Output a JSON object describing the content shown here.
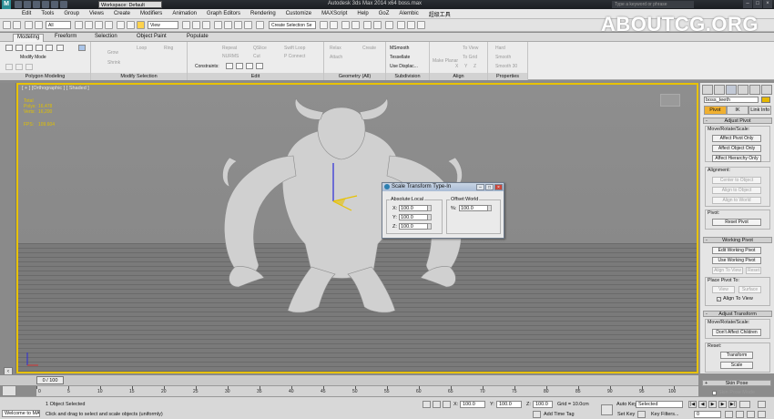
{
  "titlebar": {
    "title": "Autodesk 3ds Max  2014 x64       boss.max",
    "workspace": "Workspace: Default",
    "search_placeholder": "Type a keyword or phrase",
    "logo": "M"
  },
  "watermark": "ABOUTCG.ORG",
  "menu": [
    "Edit",
    "Tools",
    "Group",
    "Views",
    "Create",
    "Modifiers",
    "Animation",
    "Graph Editors",
    "Rendering",
    "Customize",
    "MAXScript",
    "Help",
    "GoZ",
    "Alembic",
    "超级工具"
  ],
  "toolbar": {
    "filter": "All",
    "refcoord": "View",
    "selection_set": "Create Selection Se"
  },
  "ribbon_tabs": [
    "Modeling",
    "Freeform",
    "Selection",
    "Object Paint",
    "Populate"
  ],
  "ribbon": {
    "groups": [
      "Polygon Modeling",
      "Modify Selection",
      "Edit",
      "Geometry (All)",
      "Subdivision",
      "Align",
      "Properties"
    ],
    "modify_mode": "Modify Mode",
    "modsel": [
      "Grow",
      "Shrink",
      "Loop",
      "Ring"
    ],
    "edit": [
      "Repeat",
      "NURMS",
      "QSlice",
      "Cut",
      "Swift Loop",
      "P Connect"
    ],
    "constraints_label": "Constraints:",
    "geometry": [
      "Relax",
      "Attach",
      "Create"
    ],
    "subdivision": [
      "MSmooth",
      "Tessellate",
      "Use Displac..."
    ],
    "make_planar": "Make Planar",
    "align": [
      "To View",
      "To Grid",
      "X",
      "Y",
      "Z"
    ],
    "properties": [
      "Hard",
      "Smooth",
      "Smooth 30"
    ]
  },
  "viewport": {
    "label": "[ + ] [Orthographic ] [ Shaded ]",
    "stats": {
      "total_label": "Total",
      "polys_label": "Polys:",
      "polys_value": "16,478",
      "verts_label": "Verts:",
      "verts_value": "16,200",
      "fps_label": "FPS:",
      "fps_value": "109.604"
    }
  },
  "dialog": {
    "title": "Scale Transform Type-In",
    "absolute_legend": "Absolute:Local",
    "offset_legend": "Offset:World",
    "x_label": "X:",
    "x_value": "100.0",
    "y_label": "Y:",
    "y_value": "100.0",
    "z_label": "Z:",
    "z_value": "100.0",
    "pct_label": "%:",
    "pct_value": "100.0"
  },
  "cmdpanel": {
    "object_name": "boss_teeth",
    "tabs": [
      "Pivot",
      "IK",
      "Link Info"
    ],
    "adjust_pivot": "Adjust Pivot",
    "move_rotate_scale": "Move/Rotate/Scale:",
    "affect_pivot": "Affect Pivot Only",
    "affect_object": "Affect Object Only",
    "affect_hierarchy": "Affect Hierarchy Only",
    "alignment": "Alignment:",
    "center_to_object": "Center to Object",
    "align_to_object": "Align to Object",
    "align_to_world": "Align to World",
    "pivot_label": "Pivot:",
    "reset_pivot": "Reset Pivot",
    "working_pivot": "Working Pivot",
    "edit_working_pivot": "Edit Working Pivot",
    "use_working_pivot": "Use Working Pivot",
    "align_to_view": "Align To View",
    "reset": "Reset",
    "place_pivot_to": "Place Pivot To:",
    "view": "View",
    "surface": "Surface",
    "align_to_view_chk": "Align To View",
    "adjust_transform": "Adjust Transform",
    "move_rotate_scale2": "Move/Rotate/Scale:",
    "dont_affect_children": "Don't Affect Children",
    "reset_label": "Reset:",
    "transform": "Transform",
    "scale": "Scale",
    "skin_pose": "Skin Pose",
    "skin_pose_mode": "Skin Pose Mode"
  },
  "timeline": {
    "slider": "0 / 100",
    "ticks": [
      "0",
      "5",
      "10",
      "15",
      "20",
      "25",
      "30",
      "35",
      "40",
      "45",
      "50",
      "55",
      "60",
      "65",
      "70",
      "75",
      "80",
      "85",
      "90",
      "95",
      "100"
    ]
  },
  "status": {
    "maxscript": "Welcome to MAX!",
    "selected": "1 Object Selected",
    "prompt": "Click and drag to select and scale objects (uniformly)",
    "x_label": "X:",
    "x_value": "100.0",
    "y_label": "Y:",
    "y_value": "100.0",
    "z_label": "Z:",
    "z_value": "100.0",
    "grid": "Grid = 10.0cm",
    "add_time_tag": "Add Time Tag",
    "auto_key": "Auto Key",
    "auto_key_value": "Selected",
    "set_key": "Set Key",
    "key_filters": "Key Filters...",
    "frame": "0"
  }
}
